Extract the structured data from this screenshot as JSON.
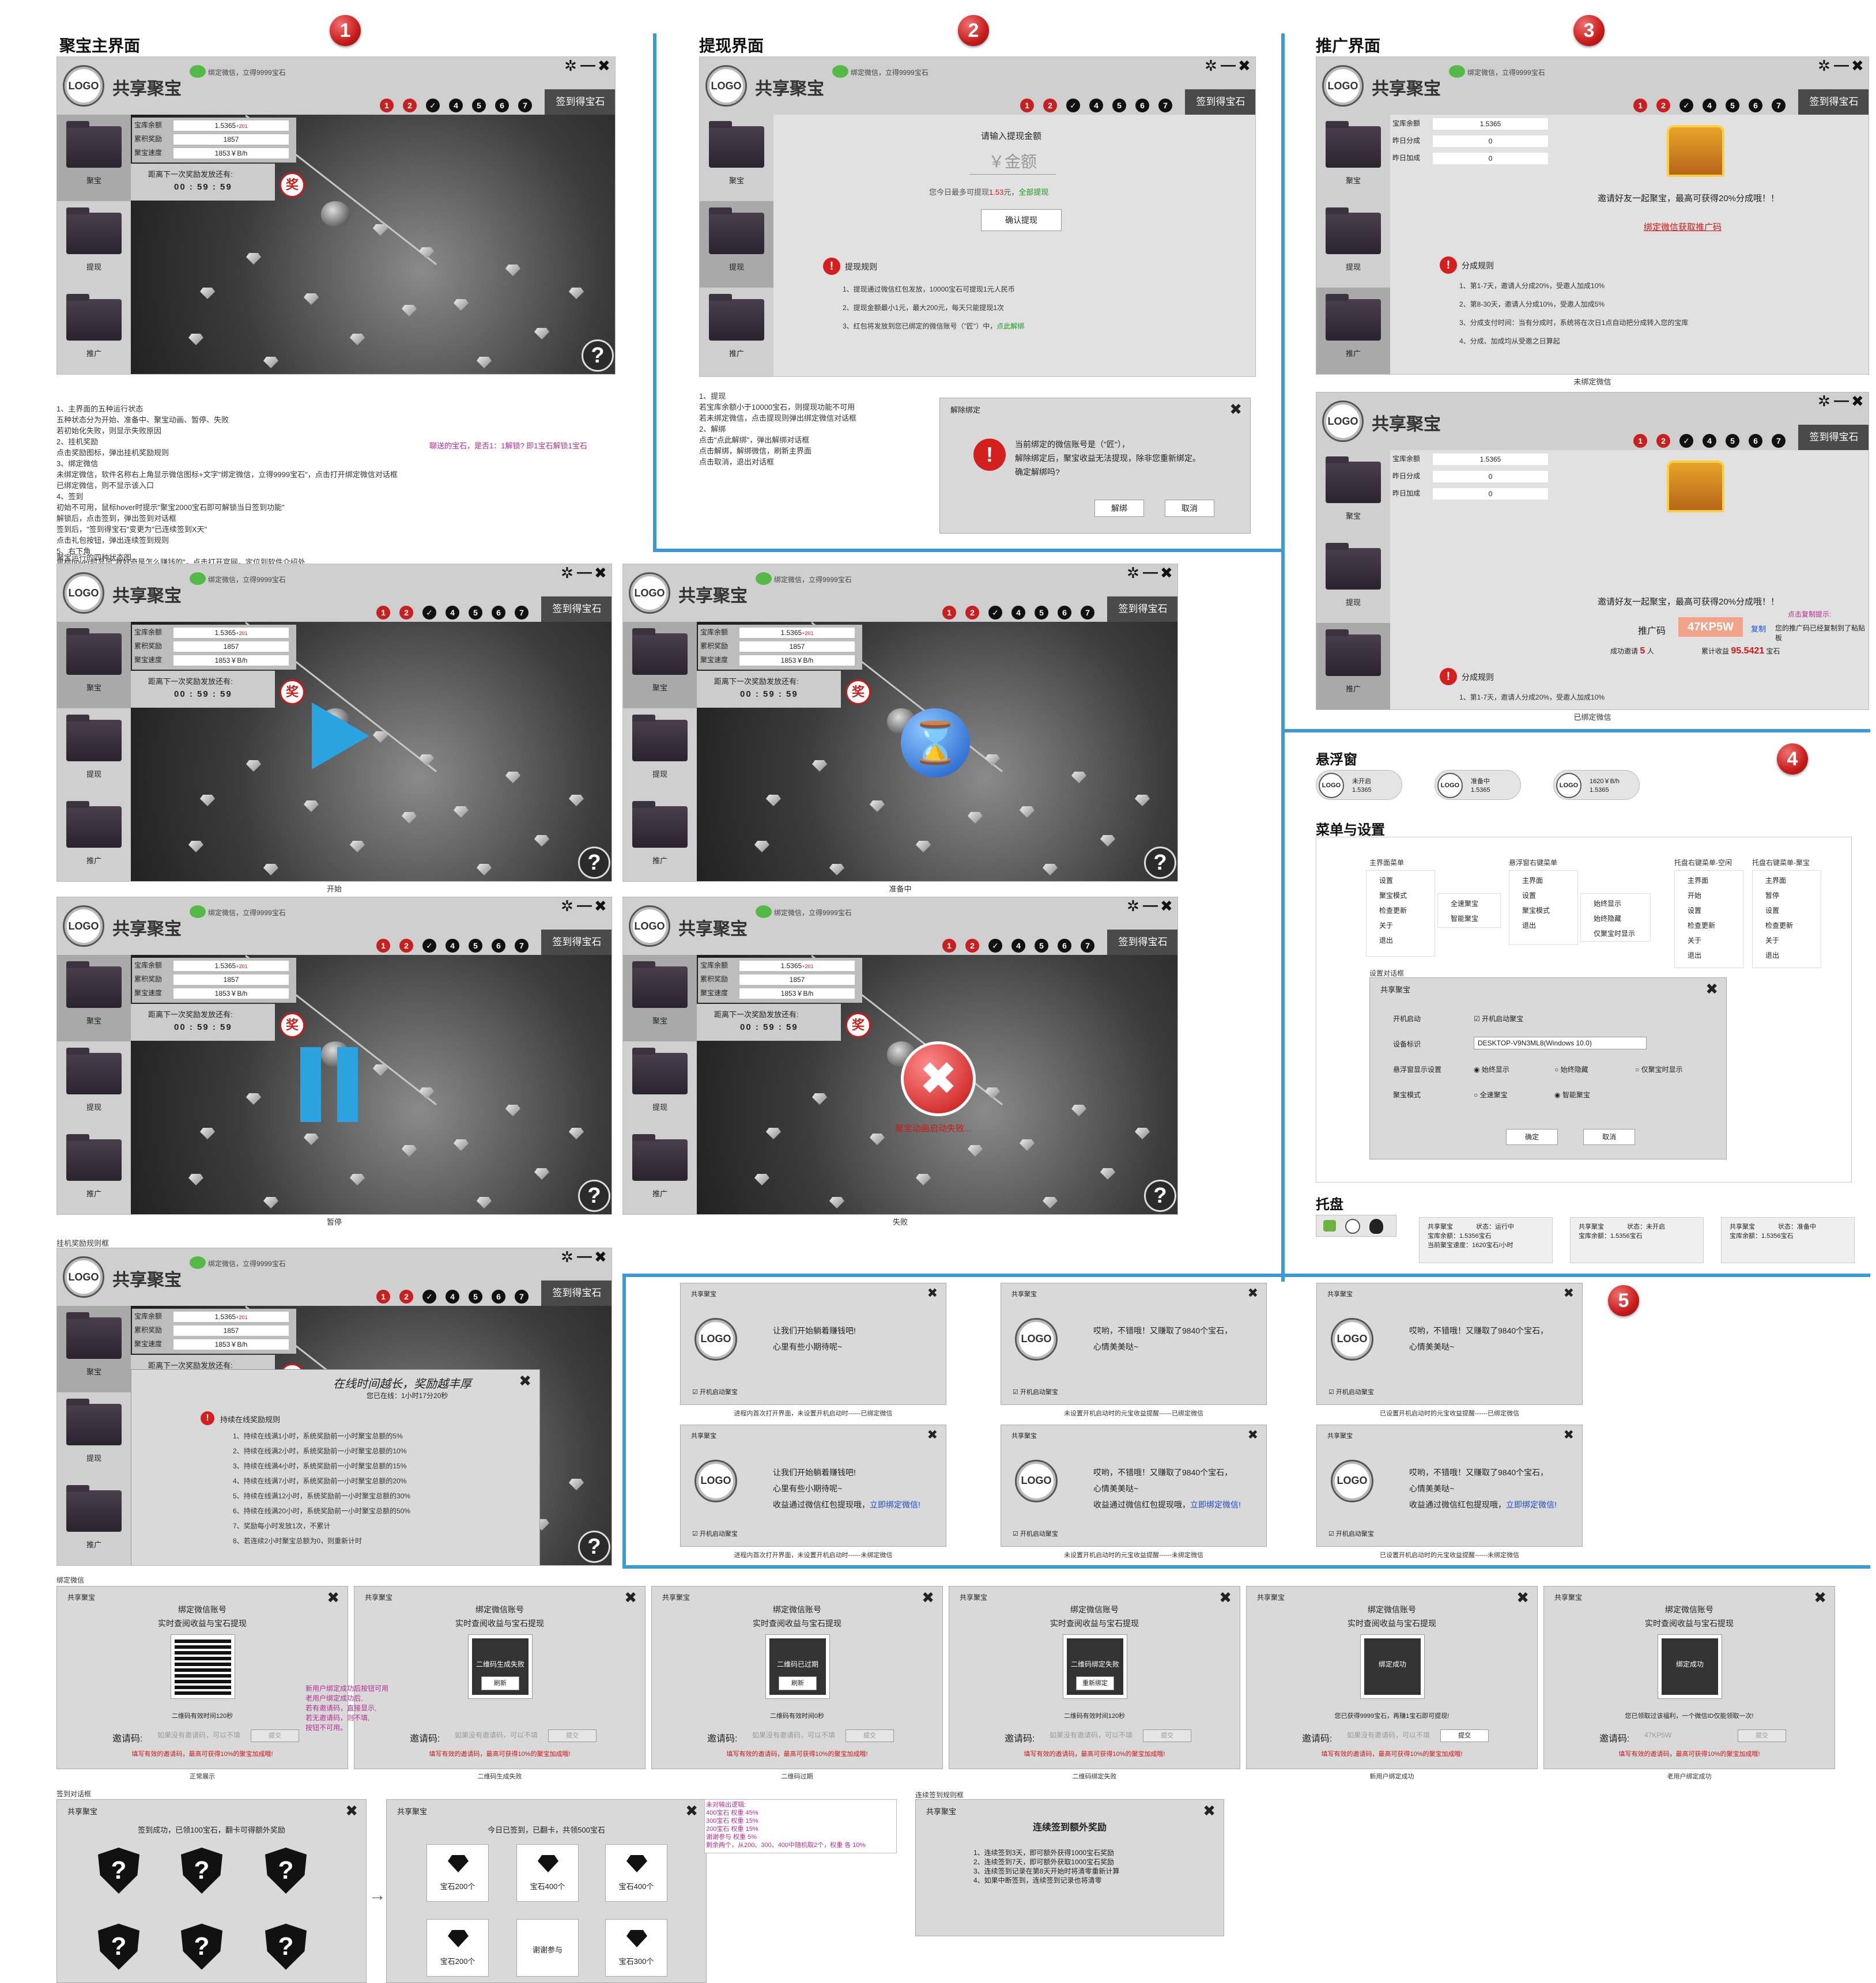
{
  "app": {
    "logo": "LOGO",
    "name": "共享聚宝",
    "wechat_hint": "绑定微信，立得9999宝石",
    "sign": "签到得宝石",
    "steps": [
      "1",
      "2",
      "✓",
      "4",
      "5",
      "6",
      "7"
    ],
    "side": [
      "聚宝",
      "提现",
      "推广"
    ],
    "help": "?"
  },
  "mining": {
    "labels": [
      "宝库余额",
      "累积奖励",
      "聚宝速度"
    ],
    "values": [
      "1.5365",
      "1857",
      "1853￥B/h"
    ],
    "suffix": "+201",
    "countdown_label": "距离下一次奖励发放还有:",
    "countdown": "00 : 59 : 59",
    "jiang": "奖"
  },
  "sections": {
    "s1": "聚宝主界面",
    "s2": "提现界面",
    "s3": "推广界面",
    "s4a": "悬浮窗",
    "s4b": "菜单与设置",
    "s4c": "托盘"
  },
  "badges": [
    "1",
    "2",
    "3",
    "4",
    "5"
  ],
  "notes": {
    "main": [
      "1、主界面的五种运行状态",
      "五种状态分为开始、准备中、聚宝动画、暂停、失败",
      "若初始化失败，则显示失败原因",
      "2、挂机奖励",
      "点击奖励图标，弹出挂机奖励规则",
      "3、绑定微信",
      "未绑定微信，软件名称右上角显示微信图标+文字\"绑定微信，立得9999宝石\"，点击打开绑定微信对话框",
      "已绑定微信，则不显示该入口",
      "4、签到",
      "初始不可用，鼠标hover时提示\"聚宝2000宝石即可解锁当日签到功能\"",
      "解锁后，点击签到，弹出签到对话框",
      "签到后，\"签到得宝石\"变更为\"已连续签到X天\"",
      "点击礼包按钮，弹出连续签到规则",
      "5、右下角",
      "鼠标hover时显示\"我好奇是怎么赚钱的\"，点击打开官网，定位到软件介绍处"
    ],
    "gift": "聊送的宝石，是否1：1解锁? 即1宝石解锁1宝石",
    "states_title": "聚宝运行的四种状态图",
    "withdraw": [
      "1、提现",
      "若宝库余额小于10000宝石，则提现功能不可用",
      "若未绑定微信，点击提现则弹出绑定微信对话框",
      "2、解绑",
      "点击\"点此解绑\"，弹出解绑对话框",
      "点击解绑，解绑微信，刷新主界面",
      "点击取消，退出对话框"
    ],
    "reward_title": "挂机奖励规则框",
    "bind_title": "绑定微信",
    "sign_title": "签到对话框",
    "streak_title": "连续签到规则框"
  },
  "state_captions": [
    "开始",
    "准备中",
    "暂停",
    "失败"
  ],
  "fail_text": "聚宝动画启动失败...",
  "withdraw": {
    "prompt": "请输入提现金额",
    "placeholder": "￥金额",
    "limit_pre": "您今日最多可提现",
    "limit_val": "1.53",
    "limit_post": "元，",
    "all": "全部提现",
    "confirm": "确认提现",
    "rules_title": "提现规则",
    "rules": [
      "1、提现通过微信红包发放，10000宝石可提现1元人民币",
      "2、提现金额最小1元，最大200元，每天只能提现1次",
      "3、红包将发放到您已绑定的微信账号（\"匠\"）中，"
    ],
    "unbind_link": "点此解绑"
  },
  "unbind": {
    "title": "解除绑定",
    "msg1": "当前绑定的微信账号是（\"匠\"），",
    "msg2": "解除绑定后，聚宝收益无法提现，除非您重新绑定。",
    "msg3": "确定解绑吗?",
    "ok": "解绑",
    "cancel": "取消"
  },
  "promo": {
    "labels": [
      "宝库余额",
      "昨日分成",
      "昨日加成"
    ],
    "values": [
      "1.5365",
      "0",
      "0"
    ],
    "invite": "邀请好友一起聚宝，最高可获得20%分成哦！！",
    "bind_link": "绑定微信获取推广码",
    "rules_title": "分成规则",
    "rules": [
      "1、第1-7天，邀请人分成20%，受邀人加成10%",
      "2、第8-30天，邀请人分成10%，受邀人加成5%",
      "3、分成支付时间：当有分成时，系统将在次日1点自动把分成转入您的宝库",
      "4、分成、加成均从受邀之日算起"
    ],
    "cap1": "未绑定微信",
    "cap2": "已绑定微信",
    "code_label": "推广码",
    "code": "47KP5W",
    "copy": "复制",
    "copied_hint": "点击复制提示:",
    "copied": "您的推广码已经复制到了粘贴板",
    "success_label": "成功邀请",
    "success_n": "5",
    "success_unit": "人",
    "income_label": "累计收益",
    "income": "95.5421",
    "income_unit": "宝石"
  },
  "floats": [
    {
      "s": "未开启",
      "v": "1.5365"
    },
    {
      "s": "准备中",
      "v": "1.5365"
    },
    {
      "s": "1620￥B/h",
      "v": "1.5365"
    }
  ],
  "menus": {
    "main_title": "主界面菜单",
    "main": [
      "设置",
      "聚宝模式",
      "检查更新",
      "关于",
      "退出"
    ],
    "mode": [
      "全速聚宝",
      "智能聚宝"
    ],
    "float_title": "悬浮窗右键菜单",
    "float": [
      "主界面",
      "设置",
      "聚宝模式",
      "退出"
    ],
    "show": [
      "始终显示",
      "始终隐藏",
      "仅聚宝时显示"
    ],
    "tray1_title": "托盘右键菜单-空闲",
    "tray1": [
      "主界面",
      "开始",
      "设置",
      "检查更新",
      "关于",
      "退出"
    ],
    "tray2_title": "托盘右键菜单-聚宝",
    "tray2": [
      "主界面",
      "暂停",
      "设置",
      "检查更新",
      "关于",
      "退出"
    ]
  },
  "settings": {
    "title": "设置对话框",
    "win_title": "共享聚宝",
    "startup": "开机启动",
    "startup_opt": "开机启动聚宝",
    "device": "设备标识",
    "device_val": "DESKTOP-V9N3ML8(Windows 10.0)",
    "float": "悬浮窗显示设置",
    "float_opts": [
      "始终显示",
      "始终隐藏",
      "仅聚宝时显示"
    ],
    "mode": "聚宝模式",
    "mode_opts": [
      "全速聚宝",
      "智能聚宝"
    ],
    "ok": "确定",
    "cancel": "取消"
  },
  "tray": [
    {
      "a": "共享聚宝",
      "b": "状态：运行中",
      "c": "宝库余额：1.5356宝石",
      "d": "当前聚宝速度：1620宝石/小时"
    },
    {
      "a": "共享聚宝",
      "b": "状态：未开启",
      "c": "宝库余额：1.5356宝石",
      "d": ""
    },
    {
      "a": "共享聚宝",
      "b": "状态：准备中",
      "c": "宝库余额：1.5356宝石",
      "d": ""
    }
  ],
  "toasts": [
    {
      "l1": "让我们开始躺着赚钱吧!",
      "l2": "心里有些小期待呢~",
      "l3": "",
      "link": "",
      "cap": "进程内首次打开界面，未设置开机启动时------已绑定微信"
    },
    {
      "l1": "哎哟，不错哦！又赚取了9840个宝石，",
      "l2": "心情美美哒~",
      "l3": "",
      "link": "",
      "cap": "未设置开机启动时的元宝收益提醒------已绑定微信"
    },
    {
      "l1": "哎哟，不错哦！又赚取了9840个宝石，",
      "l2": "心情美美哒~",
      "l3": "",
      "link": "",
      "cap": "已设置开机启动时的元宝收益提醒------已绑定微信"
    },
    {
      "l1": "让我们开始躺着赚钱吧!",
      "l2": "心里有些小期待呢~",
      "l3": "收益通过微信红包提现哦，",
      "link": "立即绑定微信!",
      "cap": "进程内首次打开界面，未设置开机启动时------未绑定微信"
    },
    {
      "l1": "哎哟，不错哦！又赚取了9840个宝石，",
      "l2": "心情美美哒~",
      "l3": "收益通过微信红包提现哦，",
      "link": "立即绑定微信!",
      "cap": "未设置开机启动时的元宝收益提醒------未绑定微信"
    },
    {
      "l1": "哎哟，不错哦！又赚取了9840个宝石，",
      "l2": "心情美美哒~",
      "l3": "收益通过微信红包提现哦，",
      "link": "立即绑定微信!",
      "cap": "已设置开机启动时的元宝收益提醒------未绑定微信"
    }
  ],
  "toast_title": "共享聚宝",
  "toast_startup": "开机启动聚宝",
  "reward": {
    "title": "在线时间越长，奖励越丰厚",
    "online": "您已在线：1小时17分20秒",
    "rules_title": "持续在线奖励规则",
    "rules": [
      "1、持续在线满1小时，系统奖励前一小时聚宝总额的5%",
      "2、持续在线满2小时，系统奖励前一小时聚宝总额的10%",
      "3、持续在线满4小时，系统奖励前一小时聚宝总额的15%",
      "4、持续在线满7小时，系统奖励前一小时聚宝总额的20%",
      "5、持续在线满12小时，系统奖励前一小时聚宝总额的30%",
      "6、持续在线满20小时，系统奖励前一小时聚宝总额的50%",
      "7、奖励每小时发放1次，不累计",
      "8、若连续2小时聚宝总额为0，则重新计时"
    ]
  },
  "bind": {
    "title": "共享聚宝",
    "h1": "绑定微信账号",
    "h2": "实时查阅收益与宝石提现",
    "invite": "邀请码:",
    "placeholder": "如果没有邀请码，可以不填",
    "submit": "提交",
    "footer": "填写有效的邀请码，最高可获得10%的聚宝加成哦!",
    "cards": [
      {
        "status": "二维码有效时间120秒",
        "overlay": "",
        "btn": "",
        "cap": "正常展示",
        "msg": ""
      },
      {
        "status": "",
        "overlay": "二维码生成失败",
        "btn": "刷新",
        "cap": "二维码生成失败",
        "msg": ""
      },
      {
        "status": "二维码有效时间0秒",
        "overlay": "二维码已过期",
        "btn": "刷新",
        "cap": "二维码过期",
        "msg": ""
      },
      {
        "status": "二维码有效时间120秒",
        "overlay": "二维码绑定失败",
        "btn": "重新绑定",
        "cap": "二维码绑定失败",
        "msg": ""
      },
      {
        "status": "您已获得9999宝石，再赚1宝石即可提现!",
        "overlay": "绑定成功",
        "btn": "",
        "cap": "新用户绑定成功",
        "msg": ""
      },
      {
        "status": "您已领取过该福利，一个微信ID仅能领取一次!",
        "overlay": "绑定成功",
        "btn": "",
        "cap": "老用户绑定成功",
        "msg": ""
      }
    ],
    "note": [
      "新用户绑定成功后按钮可用",
      "老用户绑定成功后,",
      "若有邀请码，直接显示,",
      "若无邀请码，则不填,",
      "按钮不可用。"
    ],
    "old_code": "47KP5W"
  },
  "signin": {
    "title": "共享聚宝",
    "msg1": "签到成功，已领100宝石，翻卡可得额外奖励",
    "msg2": "今日已签到，已翻卡，共领500宝石",
    "q": "?",
    "tiles": [
      "宝石200个",
      "宝石400个",
      "宝石400个",
      "宝石200个",
      "谢谢参与",
      "宝石300个"
    ],
    "weights": [
      "未对输出逻辑:",
      "400宝石    权重 45%",
      "300宝石    权重 15%",
      "200宝石    权重 15%",
      "谢谢参与    权重  5%",
      "剩余两个，从200、300、400中随机取2个，权重 各 10%"
    ]
  },
  "streak": {
    "title": "共享聚宝",
    "head": "连续签到额外奖励",
    "rules": [
      "1、连续签到3天，即可额外获得1000宝石奖励",
      "2、连续签到7天，即可额外获取1000宝石奖励",
      "3、连续签到记录在第8天开始时将清零重新计算",
      "4、如果中断签到，连续签到记录也将清零"
    ]
  }
}
